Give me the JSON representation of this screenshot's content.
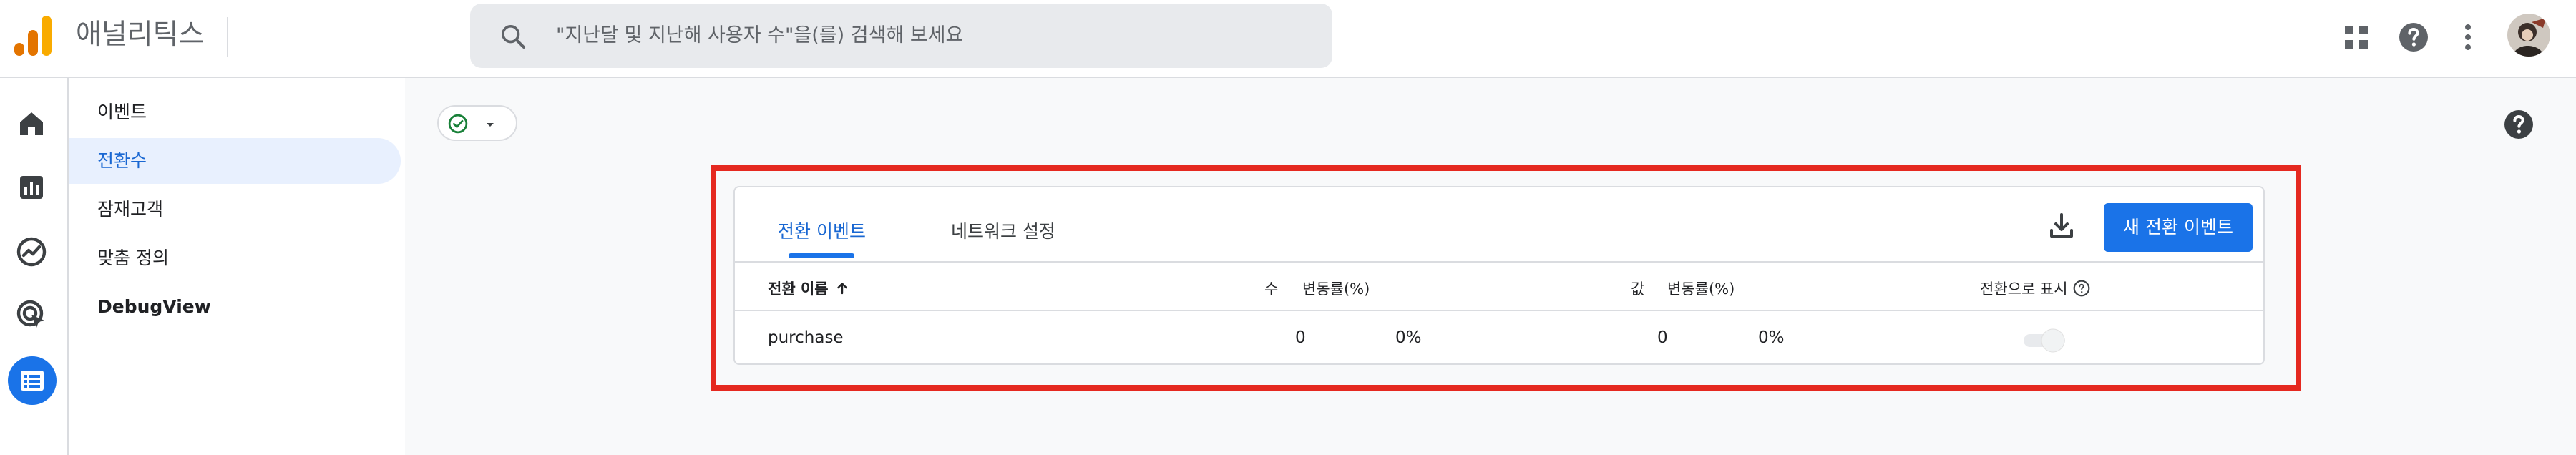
{
  "app": {
    "title": "애널리틱스"
  },
  "search": {
    "placeholder": "\"지난달 및 지난해 사용자 수\"을(를) 검색해 보세요"
  },
  "nav": {
    "items": [
      {
        "label": "이벤트"
      },
      {
        "label": "전환수",
        "active": true
      },
      {
        "label": "잠재고객"
      },
      {
        "label": "맞춤 정의"
      },
      {
        "label": "DebugView"
      }
    ]
  },
  "conversions": {
    "tabs": [
      {
        "label": "전환 이벤트",
        "active": true
      },
      {
        "label": "네트워크 설정"
      }
    ],
    "new_button_label": "새 전환 이벤트",
    "columns": {
      "name": "전환 이름",
      "count": "수",
      "count_change": "변동률(%)",
      "value": "값",
      "value_change": "변동률(%)",
      "mark_as_conversion": "전환으로 표시"
    },
    "rows": [
      {
        "name": "purchase",
        "count": "0",
        "count_change": "0%",
        "value": "0",
        "value_change": "0%",
        "mark_as_conversion": false
      }
    ]
  },
  "colors": {
    "accent": "#1a73e8",
    "highlight_border": "#e52920",
    "status_ok": "#188038"
  },
  "icons": [
    "analytics-logo-icon",
    "search-icon",
    "apps-icon",
    "help-icon",
    "more-vert-icon",
    "home-icon",
    "reports-icon",
    "explore-icon",
    "advertising-icon",
    "configure-icon",
    "check-circle-icon",
    "arrow-drop-down-icon",
    "download-icon",
    "arrow-up-icon"
  ]
}
